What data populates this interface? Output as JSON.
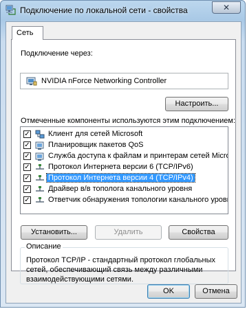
{
  "window": {
    "title": "Подключение по локальной сети - свойства",
    "close_glyph": "✕"
  },
  "tabs": [
    {
      "label": "Сеть",
      "selected": true
    }
  ],
  "connection": {
    "label": "Подключение через:",
    "adapter": "NVIDIA nForce Networking Controller",
    "configure_button": "Настроить..."
  },
  "components": {
    "label": "Отмеченные компоненты используются этим подключением:",
    "items": [
      {
        "label": "Клиент для сетей Microsoft",
        "checked": true,
        "icon": "network-client-icon",
        "selected": false
      },
      {
        "label": "Планировщик пакетов QoS",
        "checked": true,
        "icon": "service-icon",
        "selected": false
      },
      {
        "label": "Служба доступа к файлам и принтерам сетей Micro...",
        "checked": true,
        "icon": "service-icon",
        "selected": false
      },
      {
        "label": "Протокол Интернета версии 6 (TCP/IPv6)",
        "checked": true,
        "icon": "protocol-icon",
        "selected": false
      },
      {
        "label": "Протокол Интернета версии 4 (TCP/IPv4)",
        "checked": true,
        "icon": "protocol-icon",
        "selected": true
      },
      {
        "label": "Драйвер в/в тополога канального уровня",
        "checked": true,
        "icon": "protocol-icon",
        "selected": false
      },
      {
        "label": "Ответчик обнаружения топологии канального уровня",
        "checked": true,
        "icon": "protocol-icon",
        "selected": false
      }
    ],
    "checkmark": "✓"
  },
  "actions": {
    "install": "Установить...",
    "remove": "Удалить",
    "properties": "Свойства"
  },
  "description": {
    "legend": "Описание",
    "text": "Протокол TCP/IP - стандартный протокол глобальных сетей, обеспечивающий связь между различными взаимодействующими сетями."
  },
  "footer": {
    "ok": "OK",
    "cancel": "Отмена"
  },
  "colors": {
    "selection": "#3399ff",
    "title_gradient_top": "#bcd7ee",
    "panel": "#f0f0f0"
  }
}
